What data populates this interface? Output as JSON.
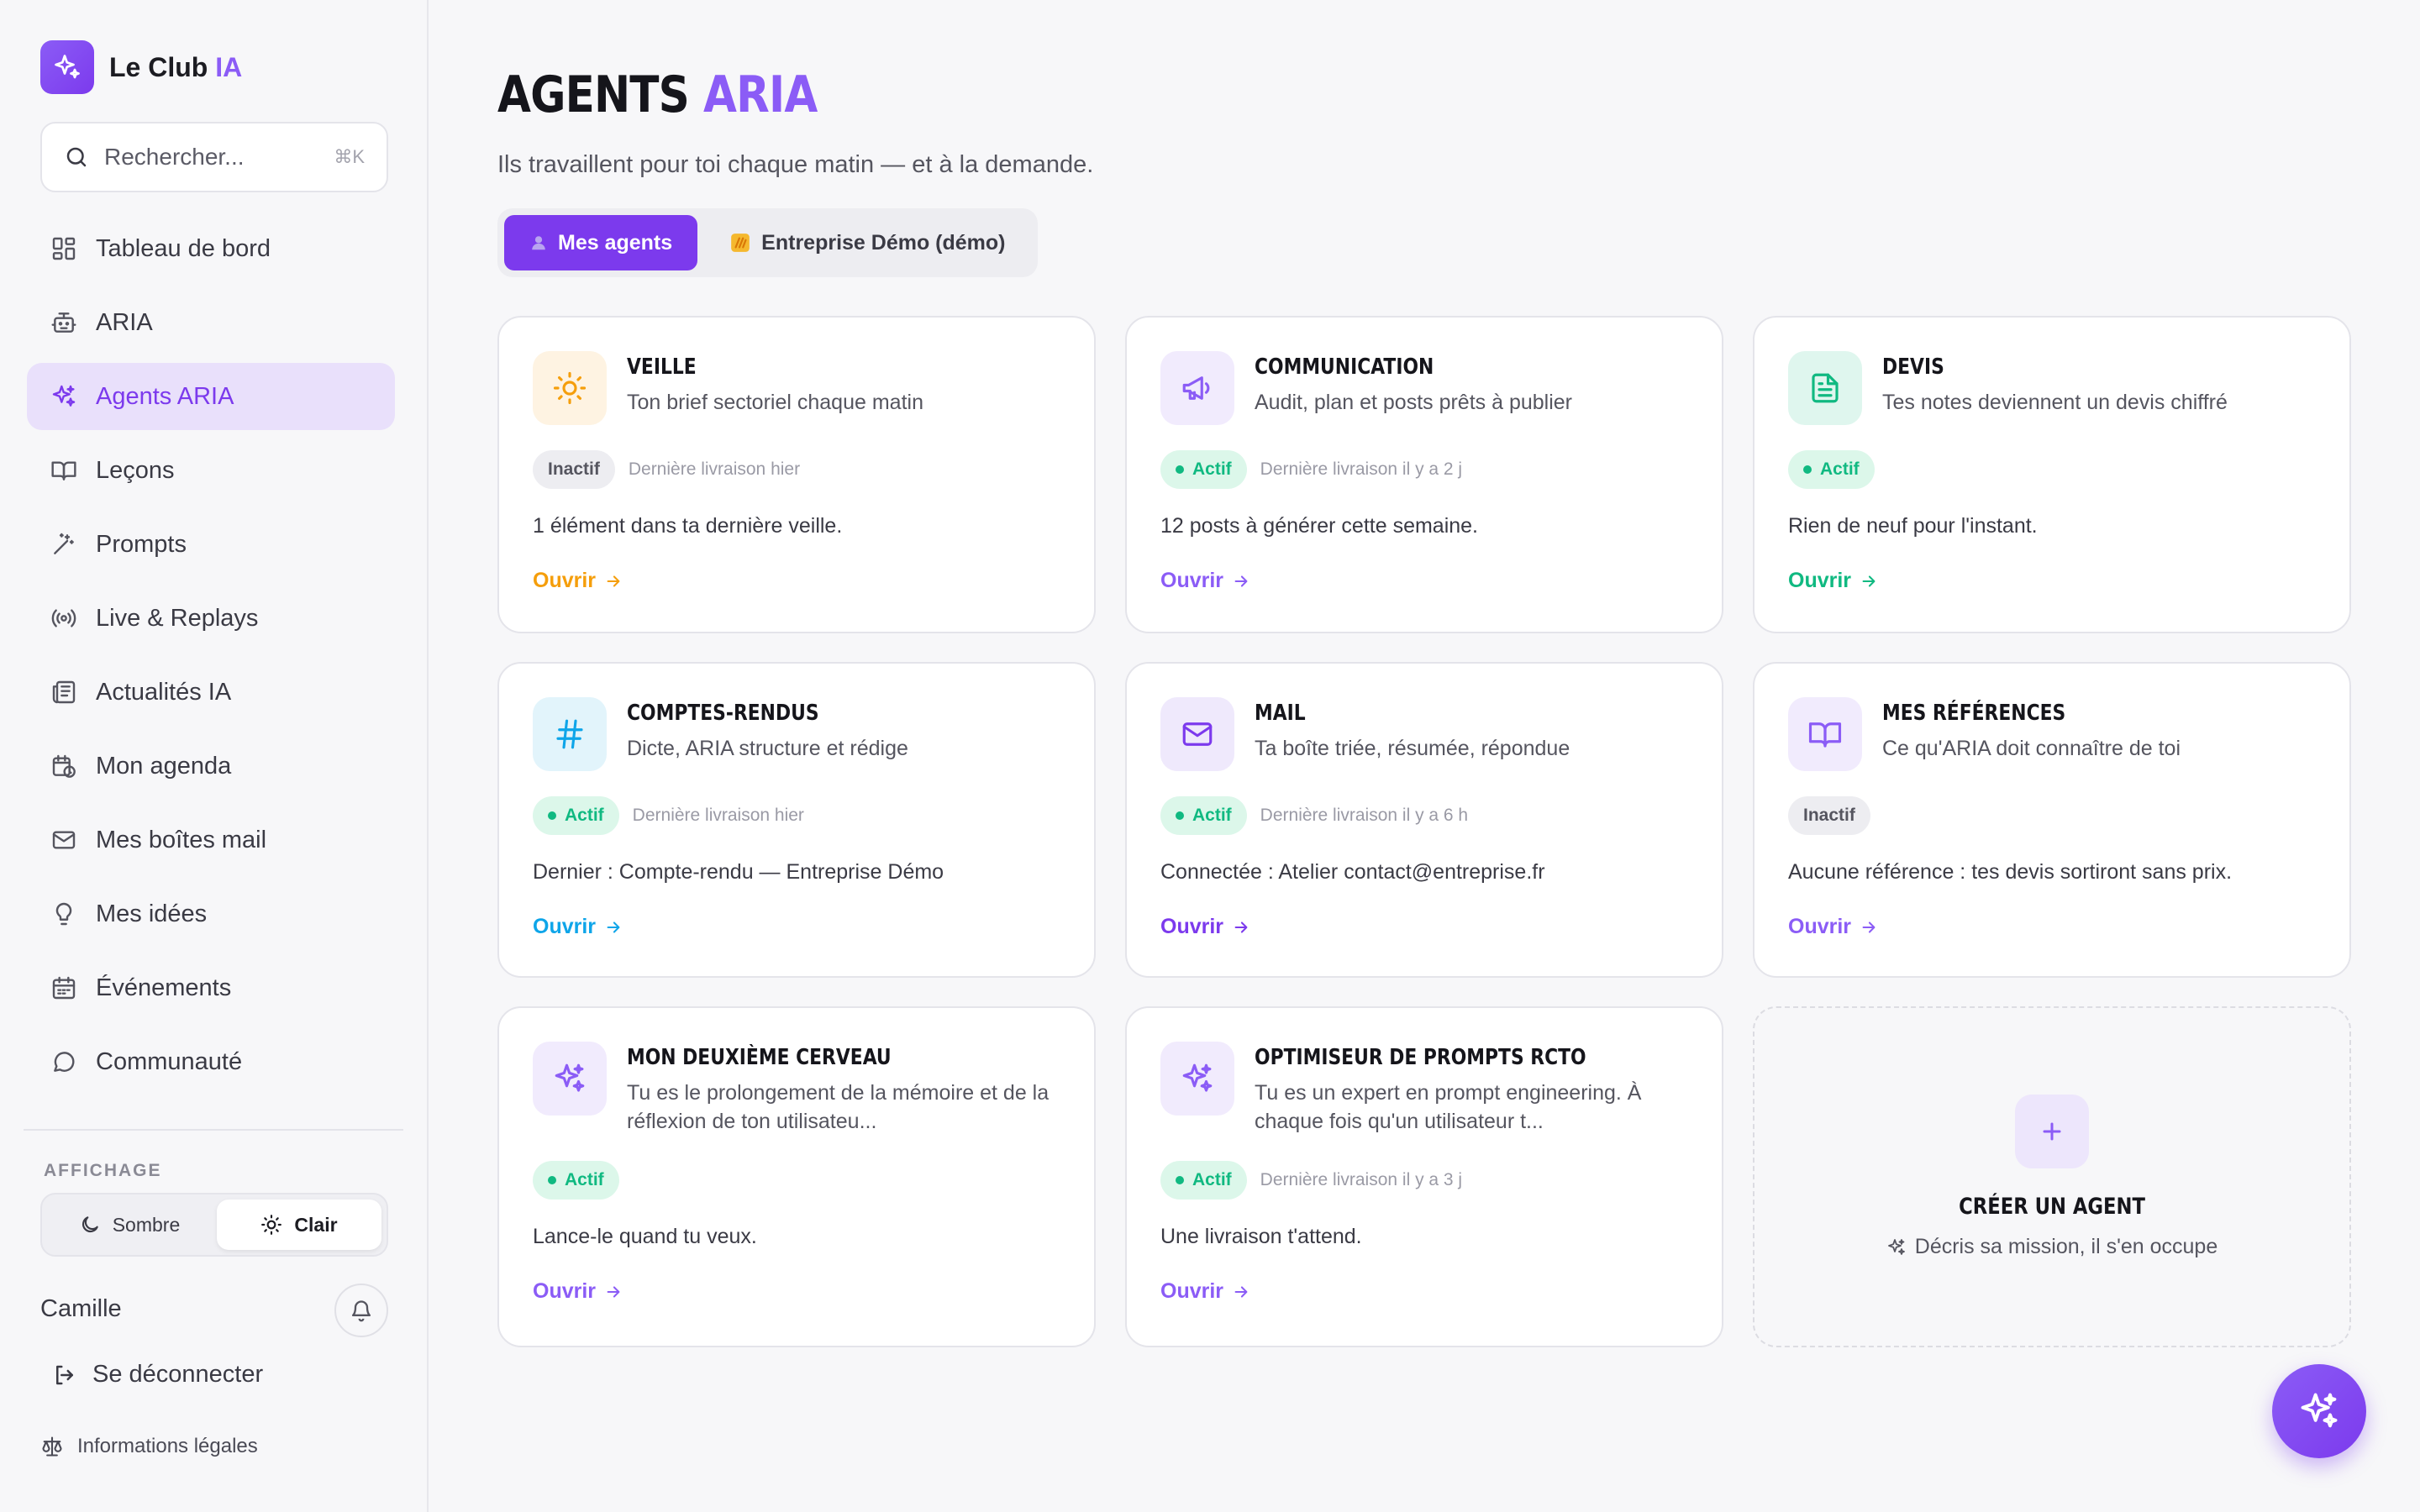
{
  "brand": {
    "name": "Le Club",
    "accent": "IA"
  },
  "search": {
    "placeholder": "Rechercher...",
    "shortcut": "⌘K"
  },
  "nav": [
    {
      "label": "Tableau de bord",
      "icon": "dashboard-icon",
      "active": false
    },
    {
      "label": "ARIA",
      "icon": "bot-icon",
      "active": false
    },
    {
      "label": "Agents ARIA",
      "icon": "sparkles-icon",
      "active": true
    },
    {
      "label": "Leçons",
      "icon": "book-icon",
      "active": false
    },
    {
      "label": "Prompts",
      "icon": "wand-icon",
      "active": false
    },
    {
      "label": "Live & Replays",
      "icon": "broadcast-icon",
      "active": false
    },
    {
      "label": "Actualités IA",
      "icon": "newspaper-icon",
      "active": false
    },
    {
      "label": "Mon agenda",
      "icon": "calendar-clock-icon",
      "active": false
    },
    {
      "label": "Mes boîtes mail",
      "icon": "mail-icon",
      "active": false
    },
    {
      "label": "Mes idées",
      "icon": "lightbulb-icon",
      "active": false
    },
    {
      "label": "Événements",
      "icon": "calendar-icon",
      "active": false
    },
    {
      "label": "Communauté",
      "icon": "chat-icon",
      "active": false
    }
  ],
  "display": {
    "label": "AFFICHAGE",
    "dark_label": "Sombre",
    "light_label": "Clair",
    "selected": "Clair"
  },
  "user": {
    "name": "Camille",
    "logout_label": "Se déconnecter",
    "legal_label": "Informations légales"
  },
  "page": {
    "title": "AGENTS",
    "title_accent": "ARIA",
    "subtitle": "Ils travaillent pour toi chaque matin — et à la demande."
  },
  "tabs": [
    {
      "label": "Mes agents",
      "icon": "person-icon",
      "active": true
    },
    {
      "label": "Entreprise Démo (démo)",
      "icon": "company-icon",
      "active": false
    }
  ],
  "colors": {
    "accent": "#7c3aed",
    "accent_light": "#8b5cf6",
    "active_green": "#10b981",
    "orange": "#f59e0b",
    "cyan": "#0ea5e9"
  },
  "agents": [
    {
      "title": "Veille",
      "desc": "Ton brief sectoriel chaque matin",
      "status": "Inactif",
      "active": false,
      "meta": "Dernière livraison hier",
      "info": "1 élément dans ta dernière veille.",
      "open_label": "Ouvrir",
      "icon": "sun-icon",
      "color": "#f59e0b",
      "bg": "#fef3e2"
    },
    {
      "title": "Communication",
      "desc": "Audit, plan et posts prêts à publier",
      "status": "Actif",
      "active": true,
      "meta": "Dernière livraison il y a 2 j",
      "info": "12 posts à générer cette semaine.",
      "open_label": "Ouvrir",
      "icon": "megaphone-icon",
      "color": "#8b5cf6",
      "bg": "#f1ebfd"
    },
    {
      "title": "Devis",
      "desc": "Tes notes deviennent un devis chiffré",
      "status": "Actif",
      "active": true,
      "meta": "",
      "info": "Rien de neuf pour l'instant.",
      "open_label": "Ouvrir",
      "icon": "document-icon",
      "color": "#10b981",
      "bg": "#dff6ee"
    },
    {
      "title": "Comptes-rendus",
      "desc": "Dicte, ARIA structure et rédige",
      "status": "Actif",
      "active": true,
      "meta": "Dernière livraison hier",
      "info": "Dernier : Compte-rendu — Entreprise Démo",
      "open_label": "Ouvrir",
      "icon": "hash-icon",
      "color": "#0ea5e9",
      "bg": "#e2f4fb"
    },
    {
      "title": "Mail",
      "desc": "Ta boîte triée, résumée, répondue",
      "status": "Actif",
      "active": true,
      "meta": "Dernière livraison il y a 6 h",
      "info": "Connectée : Atelier contact@entreprise.fr",
      "open_label": "Ouvrir",
      "icon": "mail-icon",
      "color": "#7c3aed",
      "bg": "#efe9fc"
    },
    {
      "title": "Mes références",
      "desc": "Ce qu'ARIA doit connaître de toi",
      "status": "Inactif",
      "active": false,
      "meta": "",
      "info": "Aucune référence : tes devis sortiront sans prix.",
      "open_label": "Ouvrir",
      "icon": "book-icon",
      "color": "#8b5cf6",
      "bg": "#f1ebfd"
    },
    {
      "title": "Mon deuxième cerveau",
      "desc": "Tu es le prolongement de la mémoire et de la réflexion de ton utilisateu...",
      "status": "Actif",
      "active": true,
      "meta": "",
      "info": "Lance-le quand tu veux.",
      "open_label": "Ouvrir",
      "icon": "sparkles-icon",
      "color": "#8b5cf6",
      "bg": "#f1ebfd"
    },
    {
      "title": "Optimiseur de prompts RCTO",
      "desc": "Tu es un expert en prompt engineering. À chaque fois qu'un utilisateur t...",
      "status": "Actif",
      "active": true,
      "meta": "Dernière livraison il y a 3 j",
      "info": "Une livraison t'attend.",
      "open_label": "Ouvrir",
      "icon": "sparkles-icon",
      "color": "#8b5cf6",
      "bg": "#f1ebfd"
    }
  ],
  "create_card": {
    "title": "CRÉER UN AGENT",
    "subtitle": "Décris sa mission, il s'en occupe"
  }
}
